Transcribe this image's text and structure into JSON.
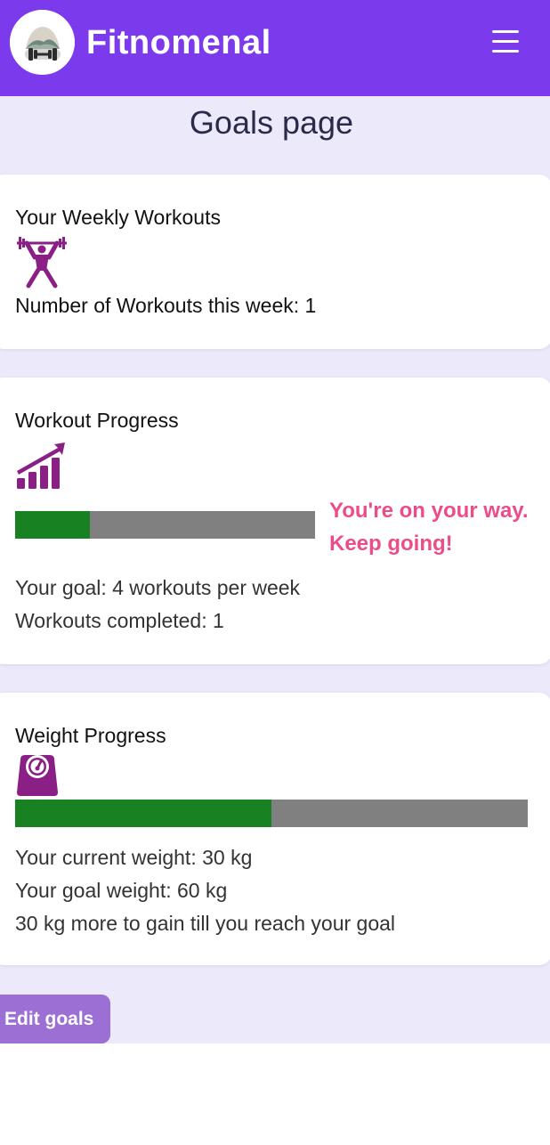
{
  "header": {
    "brand": "Fitnomenal",
    "logo_icon": "dumbbell-logo-icon",
    "menu_icon": "hamburger-menu-icon",
    "color": "#7c3aed"
  },
  "page": {
    "title": "Goals page"
  },
  "weekly": {
    "title": "Your Weekly Workouts",
    "icon": "weightlifter-icon",
    "count_text": "Number of Workouts this week: 1"
  },
  "workout": {
    "title": "Workout Progress",
    "icon": "growth-chart-icon",
    "progress": 0.25,
    "message": "You're on your way. Keep going!",
    "goal_text": "Your goal: 4 workouts per week",
    "completed_text": "Workouts completed: 1"
  },
  "weight": {
    "title": "Weight Progress",
    "icon": "weighing-scale-icon",
    "progress": 0.5,
    "current_text": "Your current weight: 30 kg",
    "goal_text": "Your goal weight: 60 kg",
    "remaining_text": "30 kg more to gain till you reach your goal"
  },
  "actions": {
    "edit_label": "Edit goals"
  },
  "colors": {
    "accent": "#7c3aed",
    "progress_fill": "#188122",
    "progress_track": "#808080",
    "icon_purple": "#8a1f86",
    "message_pink": "#ec4d89",
    "button": "#9b6fd3"
  }
}
